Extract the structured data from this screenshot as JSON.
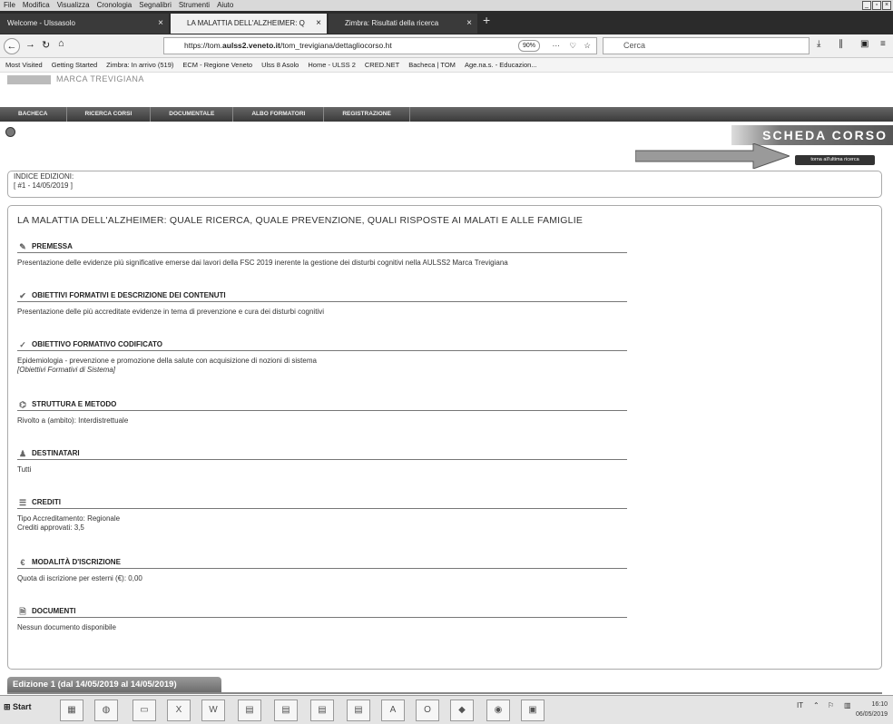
{
  "browser": {
    "menu": [
      "File",
      "Modifica",
      "Visualizza",
      "Cronologia",
      "Segnalibri",
      "Strumenti",
      "Aiuto"
    ],
    "tabs": [
      {
        "label": "Welcome - Ulssasolo"
      },
      {
        "label": "LA MALATTIA DELL'ALZHEIMER: Q"
      },
      {
        "label": "Zimbra: Risultati della ricerca"
      }
    ],
    "url_prefix": "https://tom.",
    "url_host": "aulss2.veneto.it",
    "url_path": "/tom_trevigiana/dettagliocorso.ht",
    "zoom": "90%",
    "search_placeholder": "Cerca",
    "bookmarks": [
      "Most Visited",
      "Getting Started",
      "Zimbra: In arrivo (519)",
      "ECM - Regione Veneto",
      "Ulss 8 Asolo",
      "Home - ULSS 2",
      "CRED.NET",
      "Bacheca | TOM",
      "Age.na.s. - Educazion..."
    ]
  },
  "site": {
    "logo_text": "MARCA TREVIGIANA",
    "nav": [
      "BACHECA",
      "RICERCA CORSI",
      "DOCUMENTALE",
      "ALBO FORMATORI",
      "REGISTRAZIONE"
    ],
    "section_title": "SCHEDA CORSO",
    "back_button": "torna all'ultima ricerca"
  },
  "indice": {
    "heading": "INDICE EDIZIONI:",
    "entry": "[ #1 - 14/05/2019 ]"
  },
  "course": {
    "title": "LA MALATTIA DELL'ALZHEIMER: QUALE RICERCA, QUALE PREVENZIONE, QUALI RISPOSTE AI MALATI E ALLE FAMIGLIE",
    "sections": [
      {
        "heading": "PREMESSA",
        "lines": [
          "Presentazione delle evidenze più significative emerse dai lavori della FSC 2019 inerente la gestione dei disturbi cognitivi nella AULSS2 Marca Trevigiana"
        ]
      },
      {
        "heading": "OBIETTIVI FORMATIVI E DESCRIZIONE DEI CONTENUTI",
        "lines": [
          "Presentazione delle più accreditate evidenze in tema di prevenzione e cura dei disturbi cognitivi"
        ]
      },
      {
        "heading": "OBIETTIVO FORMATIVO CODIFICATO",
        "lines": [
          "Epidemiologia - prevenzione e promozione della salute con acquisizione di nozioni di sistema"
        ],
        "italic": "[Obiettivi Formativi di Sistema]"
      },
      {
        "heading": "STRUTTURA E METODO",
        "lines": [
          "Rivolto a (ambito): Interdistrettuale"
        ]
      },
      {
        "heading": "DESTINATARI",
        "lines": [
          "Tutti"
        ]
      },
      {
        "heading": "CREDITI",
        "lines": [
          "Tipo Accreditamento: Regionale",
          "Crediti approvati: 3,5"
        ]
      },
      {
        "heading": "MODALITÀ D'ISCRIZIONE",
        "lines": [
          "Quota di iscrizione per esterni (€): 0,00"
        ]
      },
      {
        "heading": "DOCUMENTI",
        "lines": [
          "Nessun documento disponibile"
        ]
      }
    ]
  },
  "edizione_tab": "Edizione 1 (dal 14/05/2019 al 14/05/2019)",
  "taskbar": {
    "start": "Start",
    "lang": "IT",
    "time": "16:10",
    "date": "06/05/2019"
  }
}
